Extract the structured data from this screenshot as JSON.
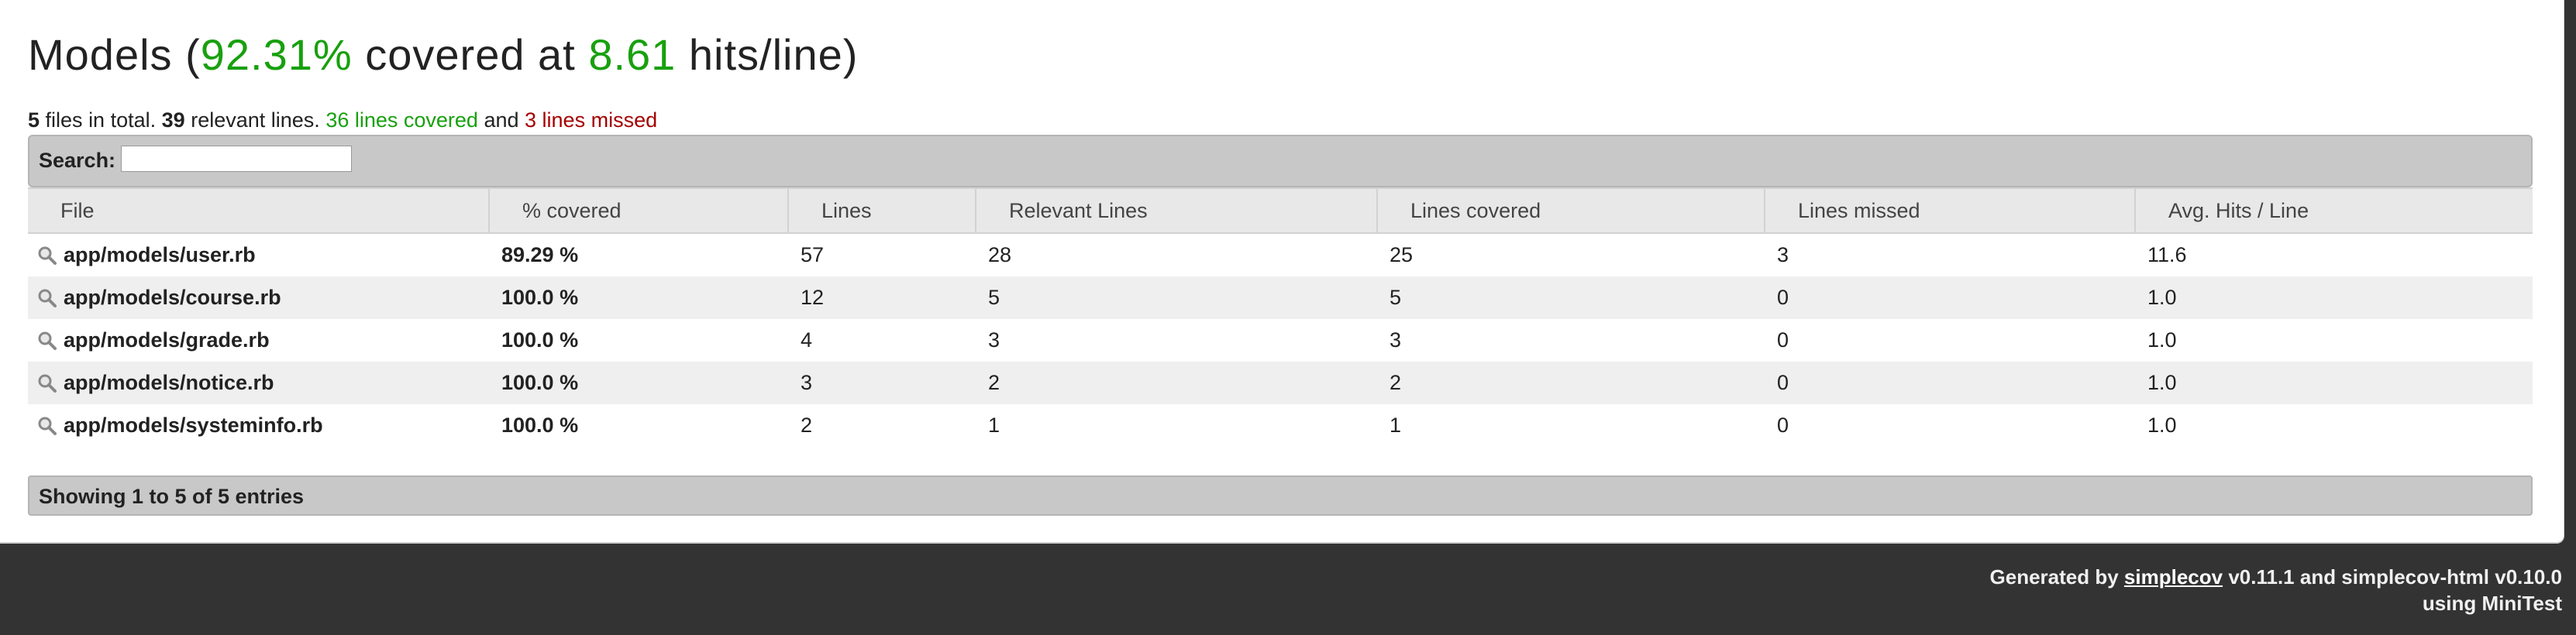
{
  "header": {
    "group": "Models",
    "open_paren": "(",
    "percent": "92.31%",
    "covered_at": "covered at",
    "hits": "8.61",
    "hits_suffix": "hits/line)"
  },
  "summary": {
    "files_count": "5",
    "files_text": "files in total.",
    "relevant_count": "39",
    "relevant_text": "relevant lines.",
    "covered": "36 lines covered",
    "and": "and",
    "missed": "3 lines missed"
  },
  "search": {
    "label": "Search:",
    "value": "",
    "placeholder": ""
  },
  "table": {
    "columns": [
      "File",
      "% covered",
      "Lines",
      "Relevant Lines",
      "Lines covered",
      "Lines missed",
      "Avg. Hits / Line"
    ],
    "rows": [
      {
        "file": "app/models/user.rb",
        "pct": "89.29 %",
        "lines": "57",
        "relevant": "28",
        "covered": "25",
        "missed": "3",
        "avg": "11.6"
      },
      {
        "file": "app/models/course.rb",
        "pct": "100.0 %",
        "lines": "12",
        "relevant": "5",
        "covered": "5",
        "missed": "0",
        "avg": "1.0"
      },
      {
        "file": "app/models/grade.rb",
        "pct": "100.0 %",
        "lines": "4",
        "relevant": "3",
        "covered": "3",
        "missed": "0",
        "avg": "1.0"
      },
      {
        "file": "app/models/notice.rb",
        "pct": "100.0 %",
        "lines": "3",
        "relevant": "2",
        "covered": "2",
        "missed": "0",
        "avg": "1.0"
      },
      {
        "file": "app/models/systeminfo.rb",
        "pct": "100.0 %",
        "lines": "2",
        "relevant": "1",
        "covered": "1",
        "missed": "0",
        "avg": "1.0"
      }
    ]
  },
  "footer": {
    "entries": "Showing 1 to 5 of 5 entries",
    "generated_by": "Generated by",
    "link": "simplecov",
    "version_text": "v0.11.1 and simplecov-html v0.10.0",
    "using": "using MiniTest"
  },
  "colors": {
    "green": "#18a00e",
    "yellow": "#d6a200",
    "red": "#a40000",
    "footer_bg": "#333333"
  },
  "icons": {
    "row_icon": "magnifier-icon"
  }
}
